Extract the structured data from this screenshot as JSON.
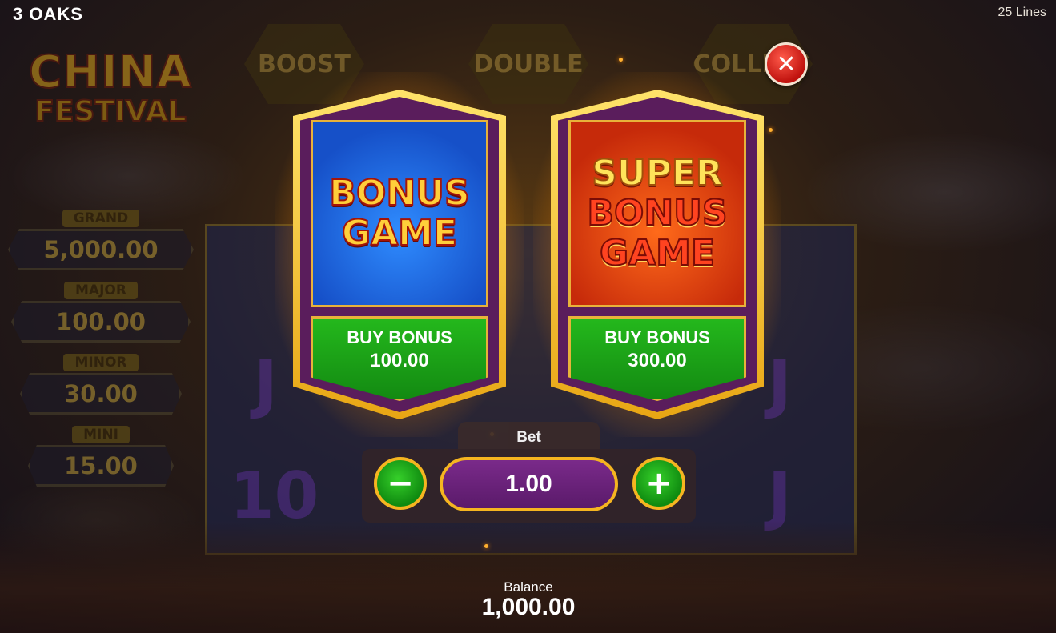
{
  "header": {
    "brand": "3 OAKS",
    "lines": "25 Lines"
  },
  "background": {
    "logo_line1": "CHINA",
    "logo_line2": "FESTIVAL",
    "feature_buttons": [
      "BOOST",
      "DOUBLE",
      "COLLECT"
    ],
    "jackpots": [
      {
        "name": "GRAND",
        "value": "5,000.00"
      },
      {
        "name": "MAJOR",
        "value": "100.00"
      },
      {
        "name": "MINOR",
        "value": "30.00"
      },
      {
        "name": "MINI",
        "value": "15.00"
      }
    ]
  },
  "dialog": {
    "close_icon": "close-icon",
    "cards": [
      {
        "title_lines": [
          "BONUS",
          "GAME"
        ],
        "buy_label": "BUY BONUS",
        "price": "100.00",
        "art_color": "#1f6ae0"
      },
      {
        "title_lines": [
          "SUPER",
          "BONUS",
          "GAME"
        ],
        "buy_label": "BUY BONUS",
        "price": "300.00",
        "art_color": "#e0400e"
      }
    ],
    "bet": {
      "label": "Bet",
      "value": "1.00",
      "minus_icon": "minus-icon",
      "plus_icon": "plus-icon"
    }
  },
  "footer": {
    "balance_label": "Balance",
    "balance_value": "1,000.00"
  },
  "colors": {
    "accent_gold": "#f5b520",
    "button_green": "#1aa018",
    "panel_purple": "#5a1d5c"
  }
}
